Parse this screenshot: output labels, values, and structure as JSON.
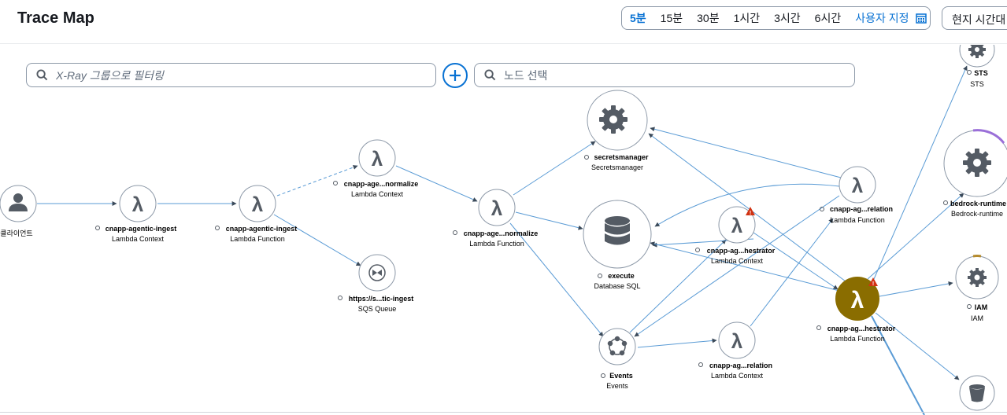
{
  "header": {
    "title": "Trace Map",
    "time_ranges": [
      "5분",
      "15분",
      "30분",
      "1시간",
      "3시간",
      "6시간"
    ],
    "active_range": "5분",
    "custom_range_label": "사용자 지정",
    "timezone_button": "현지 시간대"
  },
  "filters": {
    "group_placeholder": "X-Ray 그룹으로 필터링",
    "node_placeholder": "노드 선택"
  },
  "nodes": {
    "client": {
      "name": "클라이언트",
      "type": "",
      "icon": "user-icon"
    },
    "ingest_ctx": {
      "name": "cnapp-agentic-ingest",
      "type": "Lambda Context",
      "icon": "lambda-icon"
    },
    "ingest_fn": {
      "name": "cnapp-agentic-ingest",
      "type": "Lambda Function",
      "icon": "lambda-icon"
    },
    "normalize_ctx": {
      "name": "cnapp-age...normalize",
      "type": "Lambda Context",
      "icon": "lambda-icon"
    },
    "sqs": {
      "name": "https://s...tic-ingest",
      "type": "SQS Queue",
      "icon": "sqs-icon"
    },
    "normalize_fn": {
      "name": "cnapp-age...normalize",
      "type": "Lambda Function",
      "icon": "lambda-icon"
    },
    "secrets": {
      "name": "secretsmanager",
      "type": "Secretsmanager",
      "icon": "gear-icon"
    },
    "execute": {
      "name": "execute",
      "type": "Database SQL",
      "icon": "database-icon"
    },
    "events": {
      "name": "Events",
      "type": "Events",
      "icon": "events-icon"
    },
    "orch_ctx": {
      "name": "cnapp-ag...hestrator",
      "type": "Lambda Context",
      "icon": "lambda-icon"
    },
    "rel_fn": {
      "name": "cnapp-ag...relation",
      "type": "Lambda Function",
      "icon": "lambda-icon"
    },
    "rel_ctx": {
      "name": "cnapp-ag...relation",
      "type": "Lambda Context",
      "icon": "lambda-icon"
    },
    "orch_fn": {
      "name": "cnapp-ag...hestrator",
      "type": "Lambda Function",
      "icon": "lambda-icon"
    },
    "sts": {
      "name": "STS",
      "type": "STS",
      "icon": "gear-icon"
    },
    "bedrock": {
      "name": "bedrock-runtime",
      "type": "Bedrock-runtime",
      "icon": "gear-icon"
    },
    "iam": {
      "name": "IAM",
      "type": "IAM",
      "icon": "gear-icon"
    },
    "s3": {
      "name": "",
      "type": "",
      "icon": "bucket-icon"
    }
  },
  "colors": {
    "edge": "#5a9bd5",
    "node_border": "#8d99a8",
    "icon": "#545b64",
    "orchestrator_fill": "#8a6d00",
    "warning": "#d13212",
    "bedrock_arc": "#9a6fd8",
    "iam_arc": "#b58b2e"
  }
}
